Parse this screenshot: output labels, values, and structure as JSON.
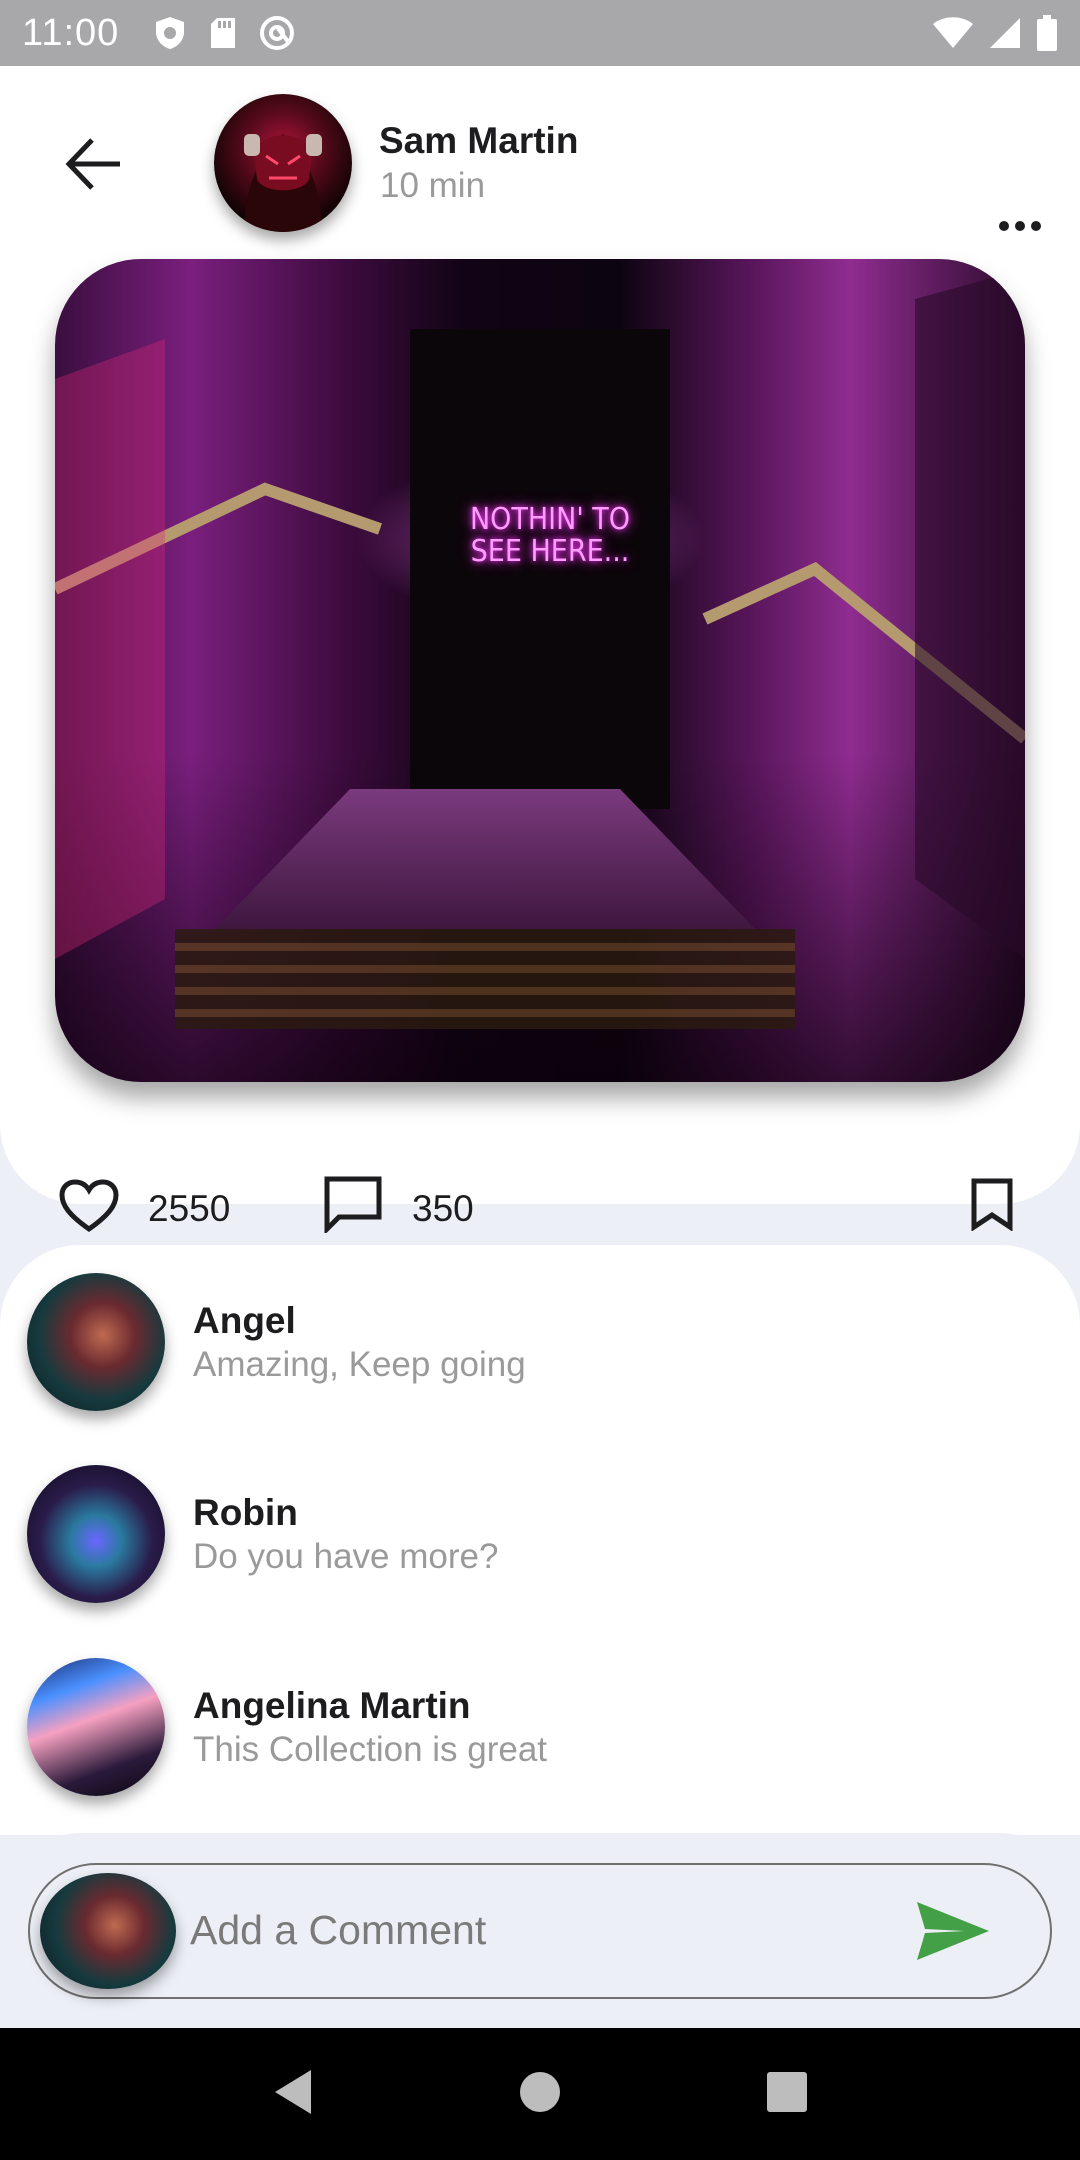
{
  "status_bar": {
    "time": "11:00",
    "icons": [
      "shield-icon",
      "sd-card-icon",
      "at-sign-icon",
      "wifi-icon",
      "cell-signal-icon",
      "battery-icon"
    ]
  },
  "post": {
    "author": "Sam Martin",
    "time": "10 min",
    "image_sign": [
      "NOTHIN' TO",
      "SEE HERE..."
    ],
    "likes": "2550",
    "comments": "350"
  },
  "comments": [
    {
      "name": "Angel",
      "text": "Amazing, Keep going"
    },
    {
      "name": "Robin",
      "text": "Do you have more?"
    },
    {
      "name": "Angelina Martin",
      "text": "This Collection is great"
    }
  ],
  "composer": {
    "placeholder": "Add a Comment",
    "value": ""
  },
  "colors": {
    "accent_send": "#43a047",
    "text_primary": "#1d1d1f",
    "text_secondary": "#9a9a9a",
    "page_bg": "#eceff6"
  }
}
